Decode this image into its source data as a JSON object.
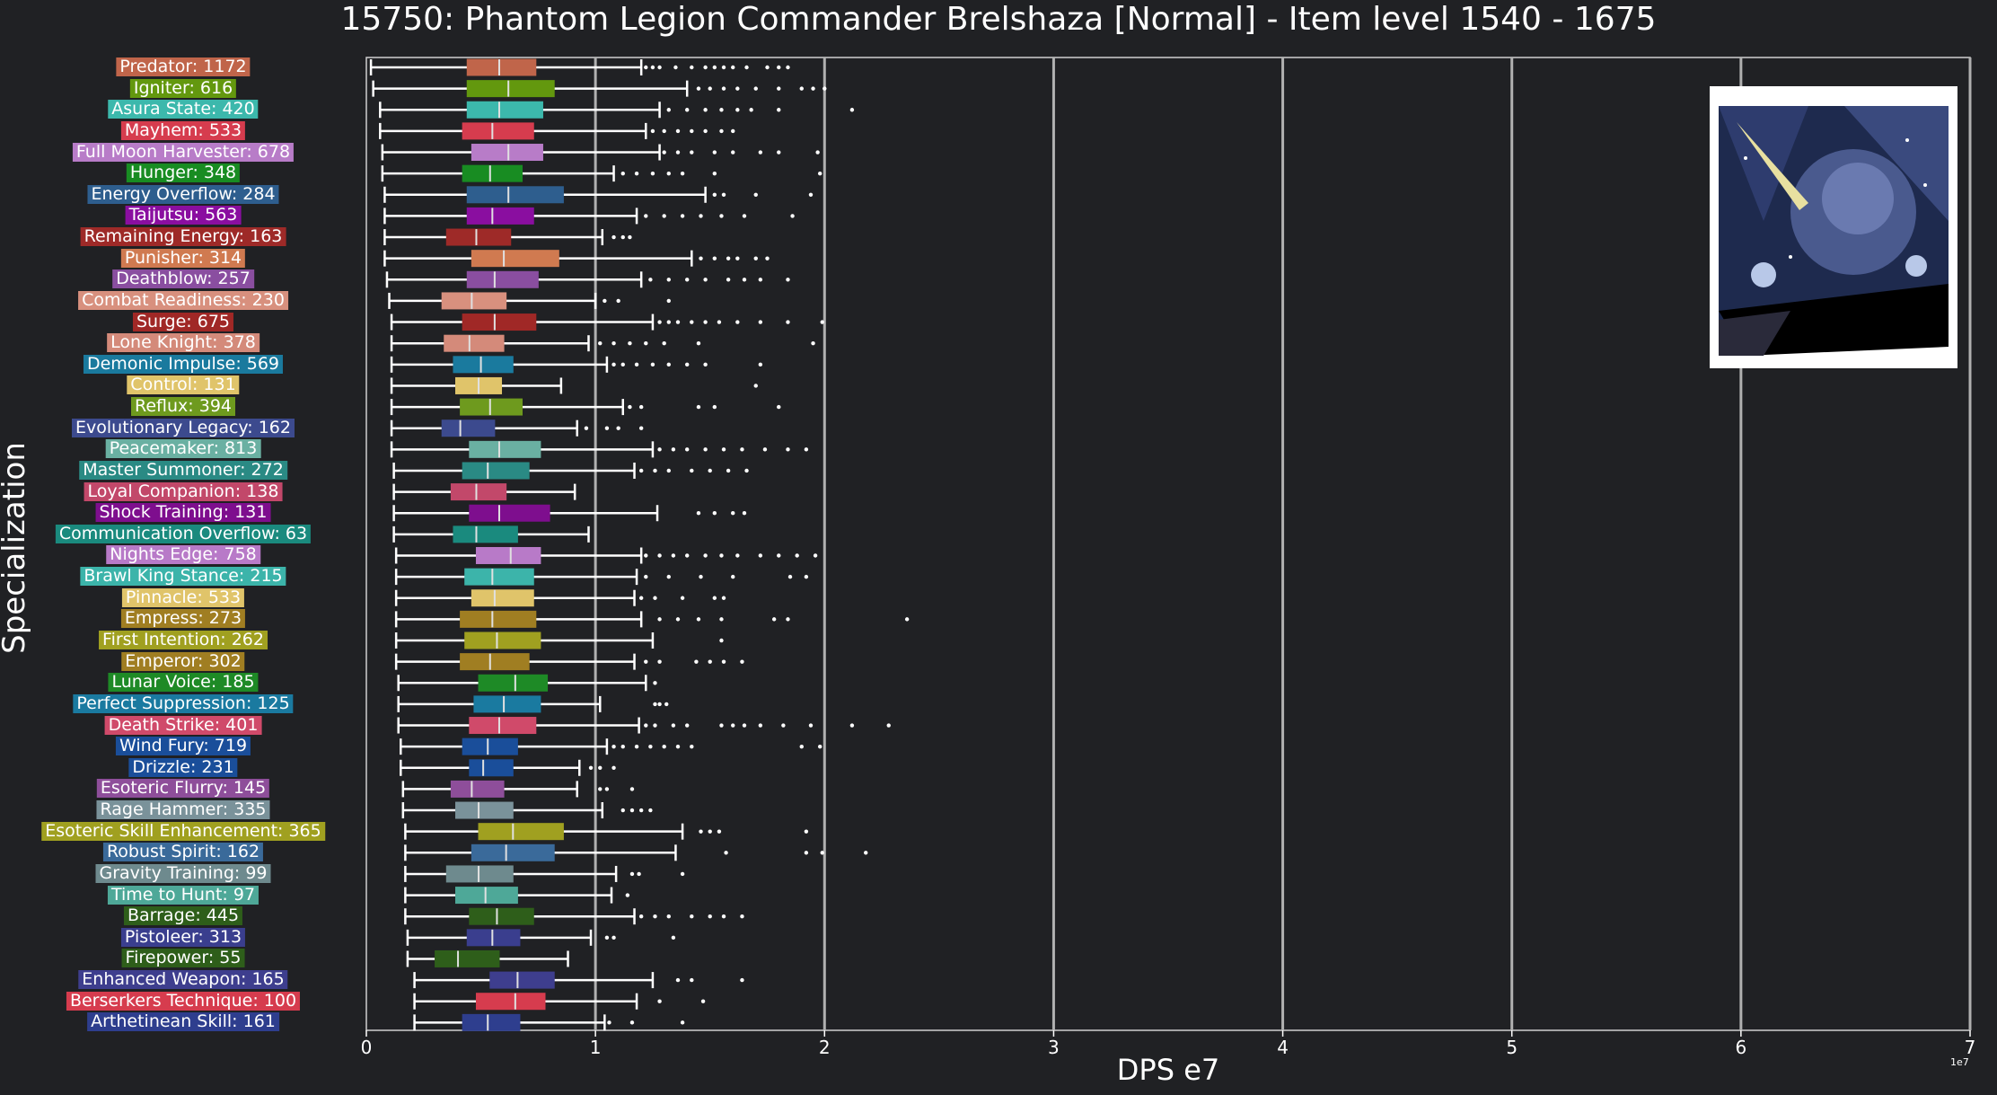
{
  "chart_data": {
    "type": "box",
    "title": "15750: Phantom Legion Commander Brelshaza [Normal] - Item level 1540 - 1675",
    "xlabel": "DPS e7",
    "ylabel": "Specialization",
    "x_scale_note": "1e7",
    "xlim": [
      0,
      7
    ],
    "x_ticks": [
      "0",
      "1",
      "2",
      "3",
      "4",
      "5",
      "6",
      "7"
    ],
    "grid": "vertical",
    "image_label": "boss portrait",
    "categories": [
      {
        "label": "Predator: 1172",
        "color": "#c0654a",
        "whislo": 0.02,
        "q1": 0.44,
        "med": 0.58,
        "q3": 0.74,
        "whishi": 1.2,
        "fliers": [
          1.22,
          1.25,
          1.28,
          1.35,
          1.42,
          1.48,
          1.52,
          1.56,
          1.6,
          1.66,
          1.75,
          1.8,
          1.84
        ]
      },
      {
        "label": "Igniter: 616",
        "color": "#63980e",
        "whislo": 0.03,
        "q1": 0.44,
        "med": 0.62,
        "q3": 0.82,
        "whislo2": 0,
        "whishi": 1.4,
        "fliers": [
          1.45,
          1.5,
          1.56,
          1.62,
          1.7,
          1.8,
          1.9,
          1.95,
          2.0
        ]
      },
      {
        "label": "Asura State: 420",
        "color": "#3cb8ac",
        "whislo": 0.06,
        "q1": 0.44,
        "med": 0.58,
        "q3": 0.77,
        "whishi": 1.28,
        "fliers": [
          1.32,
          1.4,
          1.48,
          1.55,
          1.62,
          1.68,
          1.8,
          2.12
        ]
      },
      {
        "label": "Mayhem: 533",
        "color": "#d63c4e",
        "whislo": 0.06,
        "q1": 0.42,
        "med": 0.55,
        "q3": 0.73,
        "whishi": 1.22,
        "fliers": [
          1.25,
          1.3,
          1.36,
          1.42,
          1.48,
          1.55,
          1.6
        ]
      },
      {
        "label": "Full Moon Harvester: 678",
        "color": "#b87cc8",
        "whislo": 0.07,
        "q1": 0.46,
        "med": 0.62,
        "q3": 0.77,
        "whishi": 1.28,
        "fliers": [
          1.3,
          1.36,
          1.42,
          1.52,
          1.6,
          1.72,
          1.8,
          1.97
        ]
      },
      {
        "label": "Hunger: 348",
        "color": "#188c22",
        "whislo": 0.07,
        "q1": 0.42,
        "med": 0.54,
        "q3": 0.68,
        "whishi": 1.08,
        "fliers": [
          1.12,
          1.18,
          1.25,
          1.32,
          1.38,
          1.52,
          1.98
        ]
      },
      {
        "label": "Energy Overflow: 284",
        "color": "#2e5e8e",
        "whislo": 0.08,
        "q1": 0.44,
        "med": 0.62,
        "q3": 0.86,
        "whishi": 1.48,
        "fliers": [
          1.52,
          1.56,
          1.7,
          1.94
        ]
      },
      {
        "label": "Taijutsu: 563",
        "color": "#8a0ea0",
        "whislo": 0.08,
        "q1": 0.44,
        "med": 0.55,
        "q3": 0.73,
        "whishi": 1.18,
        "fliers": [
          1.22,
          1.3,
          1.38,
          1.46,
          1.55,
          1.65,
          1.86
        ]
      },
      {
        "label": "Remaining Energy: 163",
        "color": "#9e2a28",
        "whislo": 0.08,
        "q1": 0.35,
        "med": 0.48,
        "q3": 0.63,
        "whishi": 1.03,
        "fliers": [
          1.08,
          1.12,
          1.15
        ]
      },
      {
        "label": "Punisher: 314",
        "color": "#d07a50",
        "whislo": 0.08,
        "q1": 0.46,
        "med": 0.6,
        "q3": 0.84,
        "whishi": 1.42,
        "fliers": [
          1.46,
          1.52,
          1.58,
          1.62,
          1.7,
          1.75
        ]
      },
      {
        "label": "Deathblow: 257",
        "color": "#8a4ea0",
        "whislo": 0.09,
        "q1": 0.44,
        "med": 0.56,
        "q3": 0.75,
        "whishi": 1.2,
        "fliers": [
          1.24,
          1.32,
          1.4,
          1.48,
          1.58,
          1.65,
          1.72,
          1.84
        ]
      },
      {
        "label": "Combat Readiness: 230",
        "color": "#d8907e",
        "whislo": 0.1,
        "q1": 0.33,
        "med": 0.46,
        "q3": 0.61,
        "whishi": 1.0,
        "fliers": [
          1.04,
          1.1,
          1.32
        ]
      },
      {
        "label": "Surge: 675",
        "color": "#a02826",
        "whislo": 0.11,
        "q1": 0.42,
        "med": 0.56,
        "q3": 0.74,
        "whishi": 1.25,
        "fliers": [
          1.28,
          1.32,
          1.36,
          1.42,
          1.48,
          1.54,
          1.62,
          1.72,
          1.84,
          1.99
        ]
      },
      {
        "label": "Lone Knight: 378",
        "color": "#d48a7a",
        "whislo": 0.11,
        "q1": 0.34,
        "med": 0.45,
        "q3": 0.6,
        "whishi": 0.97,
        "fliers": [
          1.02,
          1.08,
          1.15,
          1.22,
          1.3,
          1.45,
          1.95
        ]
      },
      {
        "label": "Demonic Impulse: 569",
        "color": "#1a7a9e",
        "whislo": 0.11,
        "q1": 0.38,
        "med": 0.5,
        "q3": 0.64,
        "whishi": 1.05,
        "fliers": [
          1.08,
          1.12,
          1.18,
          1.25,
          1.32,
          1.4,
          1.48,
          1.72
        ]
      },
      {
        "label": "Control: 131",
        "color": "#e0c46a",
        "whislo": 0.11,
        "q1": 0.39,
        "med": 0.49,
        "q3": 0.59,
        "whishi": 0.85,
        "fliers": [
          1.7
        ]
      },
      {
        "label": "Reflux: 394",
        "color": "#6e9a1e",
        "whislo": 0.11,
        "q1": 0.41,
        "med": 0.54,
        "q3": 0.68,
        "whishi": 1.12,
        "fliers": [
          1.15,
          1.2,
          1.45,
          1.52,
          1.8
        ]
      },
      {
        "label": "Evolutionary Legacy: 162",
        "color": "#3c4a8e",
        "whislo": 0.11,
        "q1": 0.33,
        "med": 0.41,
        "q3": 0.56,
        "whishi": 0.92,
        "fliers": [
          0.96,
          1.05,
          1.1,
          1.2
        ]
      },
      {
        "label": "Peacemaker: 813",
        "color": "#6ab0a2",
        "whislo": 0.11,
        "q1": 0.45,
        "med": 0.58,
        "q3": 0.76,
        "whishi": 1.25,
        "fliers": [
          1.28,
          1.34,
          1.4,
          1.48,
          1.56,
          1.64,
          1.74,
          1.84,
          1.92
        ]
      },
      {
        "label": "Master Summoner: 272",
        "color": "#2a8a84",
        "whislo": 0.12,
        "q1": 0.42,
        "med": 0.53,
        "q3": 0.71,
        "whishi": 1.17,
        "fliers": [
          1.2,
          1.26,
          1.32,
          1.42,
          1.5,
          1.58,
          1.66
        ]
      },
      {
        "label": "Loyal Companion: 138",
        "color": "#c2486a",
        "whislo": 0.12,
        "q1": 0.37,
        "med": 0.48,
        "q3": 0.61,
        "whishi": 0.91,
        "fliers": []
      },
      {
        "label": "Shock Training: 131",
        "color": "#7e0e8e",
        "whislo": 0.12,
        "q1": 0.45,
        "med": 0.58,
        "q3": 0.8,
        "whishi": 1.27,
        "fliers": [
          1.45,
          1.52,
          1.6,
          1.65
        ]
      },
      {
        "label": "Communication Overflow: 63",
        "color": "#1a8a7e",
        "whislo": 0.12,
        "q1": 0.38,
        "med": 0.48,
        "q3": 0.66,
        "whishi": 0.97,
        "fliers": []
      },
      {
        "label": "Nights Edge: 758",
        "color": "#b87ac8",
        "whislo": 0.13,
        "q1": 0.48,
        "med": 0.63,
        "q3": 0.76,
        "whishi": 1.2,
        "fliers": [
          1.22,
          1.28,
          1.34,
          1.4,
          1.48,
          1.55,
          1.62,
          1.72,
          1.8,
          1.88,
          1.96
        ]
      },
      {
        "label": "Brawl King Stance: 215",
        "color": "#3cb4aa",
        "whislo": 0.13,
        "q1": 0.43,
        "med": 0.55,
        "q3": 0.73,
        "whishi": 1.18,
        "fliers": [
          1.22,
          1.32,
          1.46,
          1.6,
          1.85,
          1.92
        ]
      },
      {
        "label": "Pinnacle: 533",
        "color": "#e0c46a",
        "whislo": 0.13,
        "q1": 0.46,
        "med": 0.56,
        "q3": 0.73,
        "whishi": 1.17,
        "fliers": [
          1.2,
          1.26,
          1.38,
          1.52,
          1.56
        ]
      },
      {
        "label": "Empress: 273",
        "color": "#a07e22",
        "whislo": 0.13,
        "q1": 0.41,
        "med": 0.55,
        "q3": 0.74,
        "whishi": 1.2,
        "fliers": [
          1.28,
          1.36,
          1.45,
          1.55,
          1.78,
          1.84,
          2.36
        ]
      },
      {
        "label": "First Intention: 262",
        "color": "#a0a020",
        "whislo": 0.13,
        "q1": 0.43,
        "med": 0.57,
        "q3": 0.76,
        "whishi": 1.25,
        "fliers": [
          1.55
        ]
      },
      {
        "label": "Emperor: 302",
        "color": "#a07e22",
        "whislo": 0.13,
        "q1": 0.41,
        "med": 0.54,
        "q3": 0.71,
        "whishi": 1.17,
        "fliers": [
          1.22,
          1.28,
          1.44,
          1.5,
          1.56,
          1.64
        ]
      },
      {
        "label": "Lunar Voice: 185",
        "color": "#1e8a26",
        "whislo": 0.14,
        "q1": 0.49,
        "med": 0.65,
        "q3": 0.79,
        "whishi": 1.22,
        "fliers": [
          1.26
        ]
      },
      {
        "label": "Perfect Suppression: 125",
        "color": "#1a7aa0",
        "whislo": 0.14,
        "q1": 0.47,
        "med": 0.6,
        "q3": 0.76,
        "whishi": 1.02,
        "fliers": [
          1.26,
          1.28,
          1.31
        ]
      },
      {
        "label": "Death Strike: 401",
        "color": "#d04a6a",
        "whislo": 0.14,
        "q1": 0.45,
        "med": 0.58,
        "q3": 0.74,
        "whishi": 1.19,
        "fliers": [
          1.22,
          1.26,
          1.34,
          1.4,
          1.55,
          1.6,
          1.65,
          1.72,
          1.82,
          1.94,
          2.12,
          2.28
        ]
      },
      {
        "label": "Wind Fury: 719",
        "color": "#1a4e9a",
        "whislo": 0.15,
        "q1": 0.42,
        "med": 0.53,
        "q3": 0.66,
        "whishi": 1.05,
        "fliers": [
          1.08,
          1.12,
          1.18,
          1.24,
          1.3,
          1.36,
          1.42,
          1.9,
          1.98
        ]
      },
      {
        "label": "Drizzle: 231",
        "color": "#1a4e9a",
        "whislo": 0.15,
        "q1": 0.45,
        "med": 0.51,
        "q3": 0.64,
        "whishi": 0.93,
        "fliers": [
          0.98,
          1.02,
          1.08
        ]
      },
      {
        "label": "Esoteric Flurry: 145",
        "color": "#8e4e9a",
        "whislo": 0.16,
        "q1": 0.37,
        "med": 0.46,
        "q3": 0.6,
        "whishi": 0.92,
        "fliers": [
          1.02,
          1.05,
          1.16
        ]
      },
      {
        "label": "Rage Hammer: 335",
        "color": "#7a929a",
        "whislo": 0.16,
        "q1": 0.39,
        "med": 0.49,
        "q3": 0.64,
        "whishi": 1.03,
        "fliers": [
          1.12,
          1.16,
          1.2,
          1.24
        ]
      },
      {
        "label": "Esoteric Skill Enhancement: 365",
        "color": "#a0a020",
        "whislo": 0.17,
        "q1": 0.49,
        "med": 0.64,
        "q3": 0.86,
        "whishi": 1.38,
        "fliers": [
          1.46,
          1.5,
          1.54,
          1.92
        ]
      },
      {
        "label": "Robust Spirit: 162",
        "color": "#3a6a9a",
        "whislo": 0.17,
        "q1": 0.46,
        "med": 0.61,
        "q3": 0.82,
        "whishi": 1.35,
        "fliers": [
          1.57,
          1.92,
          1.99,
          2.18
        ]
      },
      {
        "label": "Gravity Training: 99",
        "color": "#6e8a8e",
        "whislo": 0.17,
        "q1": 0.35,
        "med": 0.49,
        "q3": 0.64,
        "whishi": 1.09,
        "fliers": [
          1.16,
          1.19,
          1.38
        ]
      },
      {
        "label": "Time to Hunt: 97",
        "color": "#4ea898",
        "whislo": 0.17,
        "q1": 0.39,
        "med": 0.52,
        "q3": 0.66,
        "whishi": 1.07,
        "fliers": [
          1.14
        ]
      },
      {
        "label": "Barrage: 445",
        "color": "#2e5e1a",
        "whislo": 0.17,
        "q1": 0.45,
        "med": 0.57,
        "q3": 0.73,
        "whishi": 1.17,
        "fliers": [
          1.2,
          1.26,
          1.32,
          1.42,
          1.5,
          1.56,
          1.64
        ]
      },
      {
        "label": "Pistoleer: 313",
        "color": "#3a3e8e",
        "whislo": 0.18,
        "q1": 0.44,
        "med": 0.55,
        "q3": 0.67,
        "whishi": 0.98,
        "fliers": [
          1.05,
          1.08,
          1.34
        ]
      },
      {
        "label": "Firepower: 55",
        "color": "#2e5e1a",
        "whislo": 0.18,
        "q1": 0.3,
        "med": 0.4,
        "q3": 0.58,
        "whishi": 0.88,
        "fliers": []
      },
      {
        "label": "Enhanced Weapon: 165",
        "color": "#3e3e8e",
        "whislo": 0.21,
        "q1": 0.54,
        "med": 0.66,
        "q3": 0.82,
        "whishi": 1.25,
        "fliers": [
          1.36,
          1.42,
          1.64
        ]
      },
      {
        "label": "Berserkers Technique: 100",
        "color": "#d63c4e",
        "whislo": 0.21,
        "q1": 0.48,
        "med": 0.65,
        "q3": 0.78,
        "whishi": 1.18,
        "fliers": [
          1.28,
          1.47
        ]
      },
      {
        "label": "Arthetinean Skill: 161",
        "color": "#2e3e8e",
        "whislo": 0.21,
        "q1": 0.42,
        "med": 0.53,
        "q3": 0.67,
        "whishi": 1.04,
        "fliers": [
          1.06,
          1.16,
          1.38
        ]
      }
    ]
  }
}
